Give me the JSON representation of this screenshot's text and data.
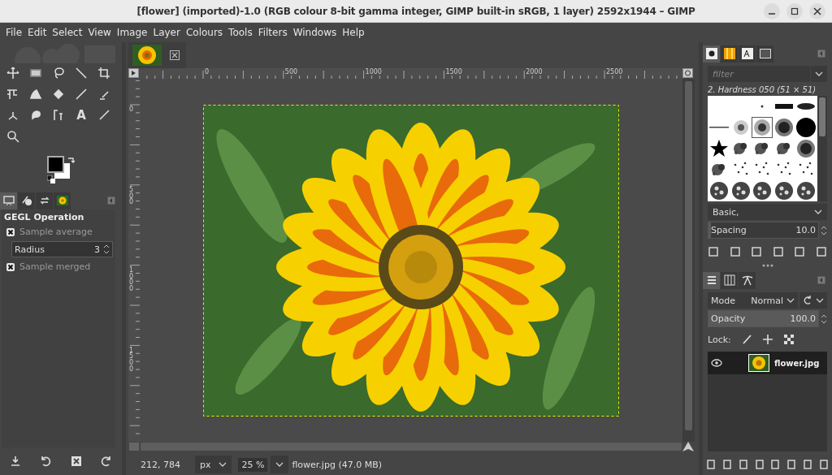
{
  "window": {
    "title": "[flower] (imported)-1.0 (RGB colour 8-bit gamma integer, GIMP built-in sRGB, 1 layer) 2592x1944 – GIMP"
  },
  "menu": [
    "File",
    "Edit",
    "Select",
    "View",
    "Image",
    "Layer",
    "Colours",
    "Tools",
    "Filters",
    "Windows",
    "Help"
  ],
  "toolbox": {
    "text_tool": "A"
  },
  "tool_options": {
    "tabs": [
      {
        "selected": true
      },
      {
        "selected": false
      },
      {
        "selected": false
      },
      {
        "selected": false
      }
    ],
    "heading": "GEGL Operation",
    "options": [
      {
        "kind": "checkbox",
        "label": "Sample average",
        "checked": true
      },
      {
        "kind": "spin",
        "label": "Radius",
        "value": "3"
      },
      {
        "kind": "checkbox",
        "label": "Sample merged",
        "checked": true
      }
    ]
  },
  "rulers": {
    "horizontal": [
      "0",
      "500",
      "1000",
      "1500",
      "2000",
      "2500"
    ],
    "vertical": [
      "0",
      "500",
      "1000",
      "1500"
    ]
  },
  "status_bar": {
    "coordinates": "212, 784",
    "unit": "px",
    "zoom": "25 %",
    "info": "flower.jpg (47.0 MB)"
  },
  "brushes": {
    "tabs": [
      {
        "selected": true
      },
      {
        "selected": false
      },
      {
        "selected": false
      },
      {
        "selected": false
      }
    ],
    "filter_placeholder": "filter",
    "brush_name": "2. Hardness 050 (51 × 51)",
    "items": [
      {
        "kind": "empty",
        "selected": false
      },
      {
        "kind": "empty",
        "selected": false
      },
      {
        "kind": "dot",
        "selected": false
      },
      {
        "kind": "bar",
        "selected": false
      },
      {
        "kind": "ellipse",
        "selected": false
      },
      {
        "kind": "line",
        "selected": false
      },
      {
        "kind": "soft",
        "selected": false
      },
      {
        "kind": "medium",
        "selected": true
      },
      {
        "kind": "fuzzy",
        "selected": false
      },
      {
        "kind": "hard",
        "selected": false
      },
      {
        "kind": "star",
        "selected": false
      },
      {
        "kind": "splatter",
        "selected": false
      },
      {
        "kind": "splatter",
        "selected": false
      },
      {
        "kind": "splatter",
        "selected": false
      },
      {
        "kind": "fuzzy",
        "selected": false
      },
      {
        "kind": "splatter",
        "selected": false
      },
      {
        "kind": "specks",
        "selected": false
      },
      {
        "kind": "specks",
        "selected": false
      },
      {
        "kind": "specks",
        "selected": false
      },
      {
        "kind": "specks",
        "selected": false
      },
      {
        "kind": "texture",
        "selected": false
      },
      {
        "kind": "texture",
        "selected": false
      },
      {
        "kind": "texture",
        "selected": false
      },
      {
        "kind": "texture",
        "selected": false
      },
      {
        "kind": "texture",
        "selected": false
      }
    ],
    "preset": "Basic,",
    "spacing": {
      "label": "Spacing",
      "value": "10.0",
      "level": 0.02
    }
  },
  "layers": {
    "tabs": [
      {
        "selected": true
      },
      {
        "selected": false
      },
      {
        "selected": false
      }
    ],
    "mode_label": "Mode",
    "mode": "Normal",
    "opacity": {
      "label": "Opacity",
      "value": "100.0",
      "level": 1
    },
    "lock_label": "Lock:",
    "items": [
      {
        "name": "flower.jpg",
        "visible": true,
        "selected": true
      }
    ]
  }
}
